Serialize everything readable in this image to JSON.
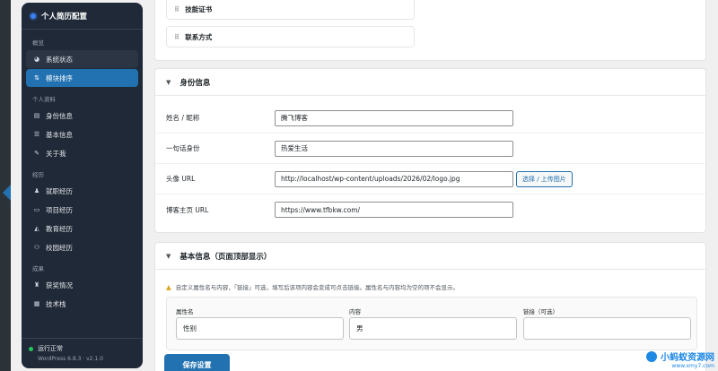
{
  "sidebar": {
    "title": "个人简历配置",
    "groups": [
      {
        "label": "概览",
        "items": [
          {
            "label": "系统状态",
            "icon": "dashboard-icon"
          },
          {
            "label": "模块排序",
            "icon": "sort-icon"
          }
        ]
      },
      {
        "label": "个人资料",
        "items": [
          {
            "label": "身份信息",
            "icon": "id-card-icon"
          },
          {
            "label": "基本信息",
            "icon": "list-icon"
          },
          {
            "label": "关于我",
            "icon": "edit-icon"
          }
        ]
      },
      {
        "label": "经历",
        "items": [
          {
            "label": "就职经历",
            "icon": "user-icon"
          },
          {
            "label": "项目经历",
            "icon": "folder-icon"
          },
          {
            "label": "教育经历",
            "icon": "graduation-icon"
          },
          {
            "label": "校园经历",
            "icon": "group-icon"
          }
        ]
      },
      {
        "label": "成果",
        "items": [
          {
            "label": "获奖情况",
            "icon": "trophy-icon"
          },
          {
            "label": "技术栈",
            "icon": "grid-icon"
          }
        ]
      }
    ],
    "status": "运行正常",
    "version": "WordPress 6.8.3 · v2.1.0"
  },
  "sort_list": {
    "items": [
      "技能证书",
      "联系方式"
    ]
  },
  "identity": {
    "title": "身份信息",
    "fields": [
      {
        "label": "姓名 / 昵称",
        "value": "腾飞博客"
      },
      {
        "label": "一句话身份",
        "value": "热爱生活"
      },
      {
        "label": "头像 URL",
        "value": "http://localhost/wp-content/uploads/2026/02/logo.jpg"
      },
      {
        "label": "博客主页 URL",
        "value": "https://www.tfbkw.com/"
      }
    ],
    "upload_label": "选择 / 上传图片"
  },
  "basic": {
    "title": "基本信息（页面顶部显示）",
    "notice": "自定义属性名与内容，「链接」可选，填写后该项内容会变成可点击链接。属性名与内容均为空的项不会显示。",
    "columns": [
      "属性名",
      "内容",
      "链接（可选）"
    ],
    "row": {
      "key": "性别",
      "value": "男",
      "link": ""
    }
  },
  "save_label": "保存设置",
  "watermark": {
    "name": "小蚂蚁资源网",
    "url": "www.xmy7.com"
  },
  "colors": {
    "accent": "#2271b1",
    "sidebar_bg": "#1f2937",
    "status_ok": "#22c55e"
  }
}
